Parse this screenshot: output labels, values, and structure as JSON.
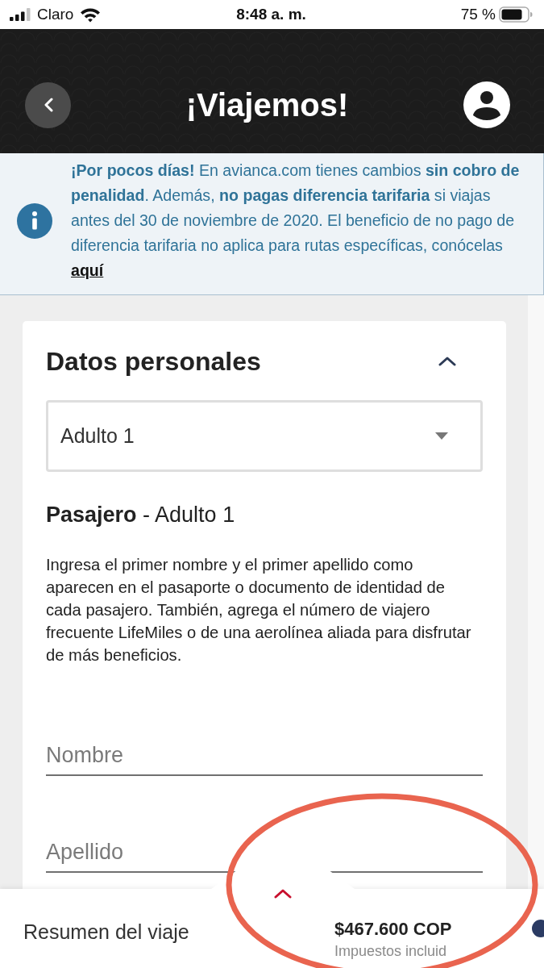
{
  "status_bar": {
    "carrier": "Claro",
    "time": "8:48 a. m.",
    "battery": "75 %"
  },
  "header": {
    "title": "¡Viajemos!"
  },
  "notice": {
    "text": "**¡Por pocos días!** En avianca.com tienes cambios **sin cobro de penalidad**. Además, **no pagas diferencia tarifaria** si viajas antes del 30 de noviembre de 2020. El beneficio de no pago de diferencia tarifaria no aplica para rutas específicas, conócelas",
    "link": "aquí"
  },
  "section": {
    "title": "Datos personales",
    "expanded": true,
    "passenger_select": {
      "value": "Adulto 1"
    },
    "passenger_heading": "**Pasajero** - Adulto 1",
    "instructions": "Ingresa el primer nombre y el primer apellido como aparecen en el pasaporte o documento de identidad de cada pasajero. También, agrega el número de viajero frecuente LifeMiles o de una aerolínea aliada para disfrutar de más beneficios.",
    "fields": [
      {
        "placeholder": "Nombre"
      },
      {
        "placeholder": "Apellido"
      }
    ]
  },
  "summary_bar": {
    "label": "Resumen del viaje",
    "expanded": false,
    "price": "$467.600 COP",
    "taxes_note": "Impuestos incluid"
  },
  "highlight": {
    "kind": "ellipse"
  }
}
